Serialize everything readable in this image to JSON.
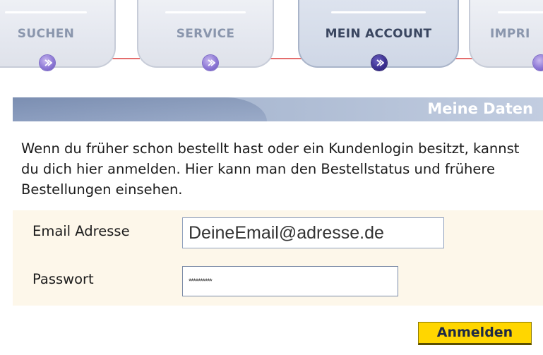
{
  "nav": {
    "tabs": [
      {
        "label": "SUCHEN"
      },
      {
        "label": "SERVICE"
      },
      {
        "label": "MEIN ACCOUNT"
      },
      {
        "label": "IMPRI"
      }
    ],
    "active_tab": "MEIN ACCOUNT"
  },
  "panel": {
    "title": "Meine Daten",
    "intro_text": "Wenn du früher schon bestellt hast oder ein Kundenlogin besitzt, kannst du dich hier anmelden. Hier kann man den Bestellstatus und frühere Bestellungen einsehen."
  },
  "form": {
    "email_label": "Email Adresse",
    "email_value": "DeineEmail@adresse.de",
    "password_label": "Passwort",
    "password_value": "**********",
    "submit_label": "Anmelden"
  },
  "colors": {
    "accent_button": "#ffd600",
    "header_blue": "#8a9cbd",
    "form_background": "#fdf7ea",
    "tab_text": "#8a96ad",
    "active_tab_text": "#3a4660"
  },
  "icons": {
    "tab_button": "arrow-circle-icon"
  }
}
